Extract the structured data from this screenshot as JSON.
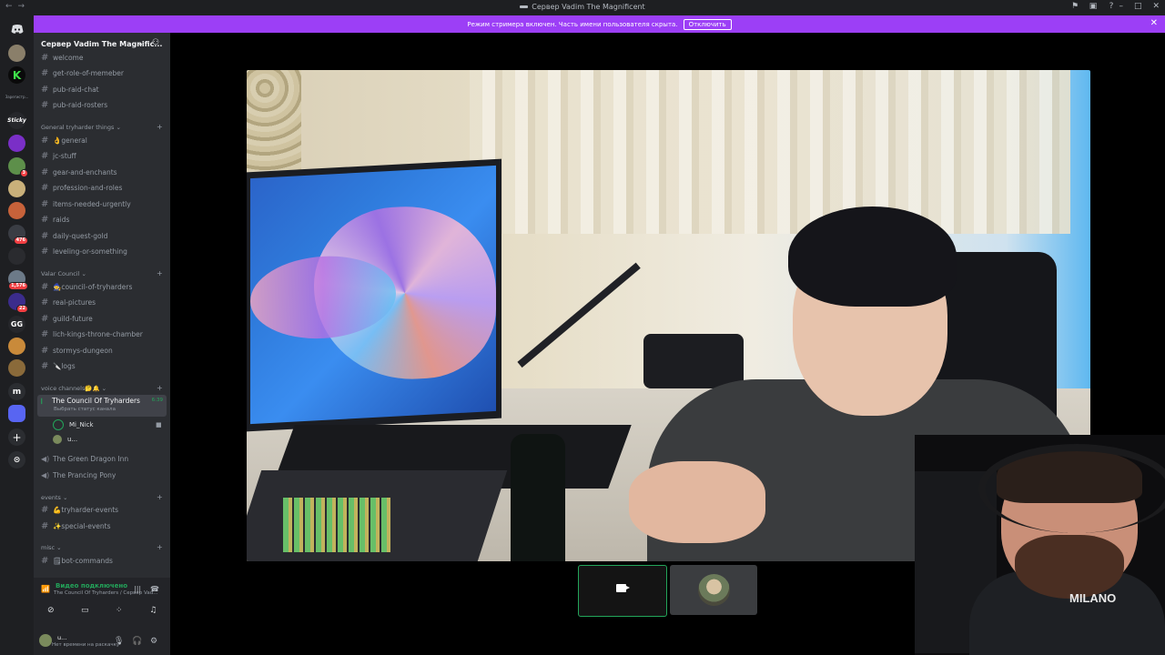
{
  "window": {
    "title": "Сервер Vadim The Magnificent"
  },
  "banner": {
    "text": "Режим стримера включен. Часть имени пользователя скрыта.",
    "button": "Отключить"
  },
  "rail": {
    "servers": [
      {
        "label": "",
        "badge": ""
      },
      {
        "label": "K",
        "badge": ""
      },
      {
        "label": "Зарегистр...",
        "badge": ""
      },
      {
        "label": "Sticky",
        "badge": ""
      },
      {
        "label": "",
        "badge": ""
      },
      {
        "label": "",
        "badge": "3"
      },
      {
        "label": "",
        "badge": ""
      },
      {
        "label": "",
        "badge": ""
      },
      {
        "label": "",
        "badge": "476"
      },
      {
        "label": "",
        "badge": ""
      },
      {
        "label": "",
        "badge": "1,576"
      },
      {
        "label": "",
        "badge": "22"
      },
      {
        "label": "GG",
        "badge": ""
      },
      {
        "label": "",
        "badge": ""
      },
      {
        "label": "",
        "badge": ""
      },
      {
        "label": "m",
        "badge": ""
      },
      {
        "label": "",
        "badge": ""
      }
    ]
  },
  "server": {
    "name": "Сервер Vadim The Magnific..."
  },
  "channels_top": [
    {
      "name": "welcome"
    },
    {
      "name": "get-role-of-memeber"
    },
    {
      "name": "pub-raid-chat"
    },
    {
      "name": "pub-raid-rosters"
    }
  ],
  "cat1": {
    "name": "General tryharder things",
    "channels": [
      {
        "name": "👌general"
      },
      {
        "name": "jc-stuff"
      },
      {
        "name": "gear-and-enchants"
      },
      {
        "name": "profession-and-roles"
      },
      {
        "name": "items-needed-urgently"
      },
      {
        "name": "raids"
      },
      {
        "name": "daily-quest-gold"
      },
      {
        "name": "leveling-or-something"
      }
    ]
  },
  "cat2": {
    "name": "Valar Council",
    "channels": [
      {
        "name": "🧙council-of-tryharders"
      },
      {
        "name": "real-pictures"
      },
      {
        "name": "guild-future"
      },
      {
        "name": "lich-kings-throne-chamber"
      },
      {
        "name": "stormys-dungeon"
      },
      {
        "name": "🔪logs"
      }
    ]
  },
  "cat3": {
    "name": "voice channels🤔🔔",
    "active": {
      "name": "The Council Of Tryharders",
      "status": "Выбрать статус канала",
      "time": "6:39"
    },
    "users": [
      {
        "name": "Mi_Nick"
      },
      {
        "name": "u..."
      }
    ],
    "channels": [
      {
        "name": "The Green Dragon Inn"
      },
      {
        "name": "The Prancing Pony"
      }
    ]
  },
  "cat4": {
    "name": "events",
    "channels": [
      {
        "name": "💪tryharder-events"
      },
      {
        "name": "✨special-events"
      }
    ]
  },
  "cat5": {
    "name": "misc",
    "channels": [
      {
        "name": "🗒bot-commands"
      }
    ]
  },
  "voice_panel": {
    "status": "Видео подключено",
    "sub": "The Council Of Tryharders / Сервер Vad..."
  },
  "user_panel": {
    "name": "u...",
    "status": "Нет времени на раскачку"
  },
  "webcam": {
    "shirt_text": "MILANO"
  },
  "colors": {
    "accent": "#9c3ff6",
    "green": "#23a55a",
    "sidebar": "#2b2d31",
    "rail": "#1e1f22"
  }
}
